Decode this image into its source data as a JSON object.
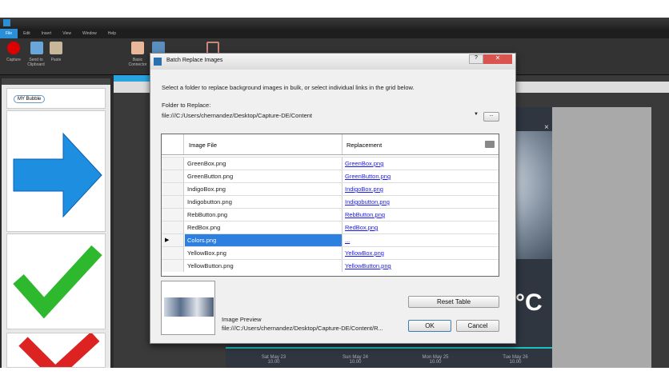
{
  "app": {
    "menu": [
      "File",
      "Edit",
      "Insert",
      "View",
      "Window",
      "Help"
    ],
    "ribbon": [
      "Capture",
      "Send to Clipboard",
      "Paste",
      "Basic Connector"
    ],
    "palette": {
      "search_text": "MY Bubble"
    }
  },
  "weather": {
    "temperature_unit": "°C",
    "forecast": [
      {
        "day": "Sat May 23",
        "time": "10.00"
      },
      {
        "day": "Sun May 24",
        "time": "10.00"
      },
      {
        "day": "Mon May 25",
        "time": "10.00"
      },
      {
        "day": "Tue May 26",
        "time": "10.00"
      }
    ]
  },
  "dialog": {
    "title": "Batch Replace Images",
    "instructions": "Select a folder to replace background images in bulk, or select individual links in the grid below.",
    "folder_label": "Folder to Replace:",
    "folder_value": "file:///C:/Users/chernandez/Desktop/Capture-DE/Content",
    "browse_label": "...",
    "grid": {
      "columns": [
        "Image File",
        "Replacement"
      ],
      "rows": [
        {
          "file": "GreenBox.png",
          "replacement": "GreenBox.png"
        },
        {
          "file": "GreenButton.png",
          "replacement": "GreenButton.png"
        },
        {
          "file": "IndigoBox.png",
          "replacement": "IndigoBox.png"
        },
        {
          "file": "Indigobutton.png",
          "replacement": "Indigobutton.png"
        },
        {
          "file": "RebButton.png",
          "replacement": "RebButton.png"
        },
        {
          "file": "RedBox.png",
          "replacement": "RedBox.png"
        },
        {
          "file": "Colors.png",
          "replacement": "..."
        },
        {
          "file": "YellowBox.png",
          "replacement": "YellowBox.png"
        },
        {
          "file": "YellowButton.png",
          "replacement": "YellowButton.png"
        }
      ],
      "current_row": 6
    },
    "preview_label": "Image Preview",
    "preview_path": "file:///C:/Users/chernandez/Desktop/Capture-DE/Content/R...",
    "reset_label": "Reset Table",
    "ok_label": "OK",
    "cancel_label": "Cancel",
    "help_icon": "question-icon",
    "close_icon": "close-icon"
  }
}
